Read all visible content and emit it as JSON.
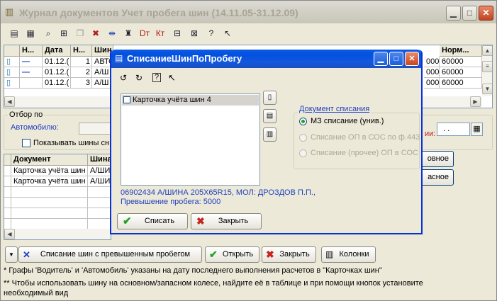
{
  "main": {
    "title": "Журнал документов  Учет пробега шин (14.11.05-31.12.09)"
  },
  "top_grid": {
    "headers": [
      "Н...",
      "Дата",
      "Н...",
      "Шин",
      "Норм..."
    ],
    "rows": [
      {
        "date": "01.12.(",
        "num": "1",
        "tire": "АВТО",
        "val": "000",
        "norm": "60000"
      },
      {
        "date": "01.12.(",
        "num": "2",
        "tire": "А/Ш",
        "val": "000",
        "norm": "60000"
      },
      {
        "date": "01.12.(",
        "num": "3",
        "tire": "А/Ш",
        "val": "000",
        "norm": "60000"
      }
    ]
  },
  "filter": {
    "group_label": "Отбор по",
    "auto_label": "Автомобилю:",
    "show_tires_label": "Показывать шины сн",
    "date_suffix_label": "ии:",
    "date_value": ". ."
  },
  "bottom_grid": {
    "headers": [
      "Документ",
      "Шина"
    ],
    "rows": [
      {
        "doc": "Карточка учёта шин",
        "tire": "А/ШИ"
      },
      {
        "doc": "Карточка учёта шин",
        "tire": "А/ШИ"
      }
    ]
  },
  "right_buttons": {
    "basic": "овное",
    "spare": "асное"
  },
  "bottom_bar": {
    "writeoff_label": "Списание шин с превышенным пробегом",
    "open_label": "Открыть",
    "close_label": "Закрыть",
    "columns_label": "Колонки"
  },
  "notes": {
    "line1": "* Графы 'Водитель' и 'Автомобиль' указаны на дату последнего выполнения расчетов в \"Карточках шин\"",
    "line2": "** Чтобы использовать шину на основном/запасном колесе, найдите её в таблице и при помощи кнопок установите",
    "line3": "необходимый вид"
  },
  "dialog": {
    "title": "СписаниеШинПоПробегу",
    "list_item": "Карточка учёта шин 4",
    "doc_group_label": "Документ списания",
    "options": [
      {
        "label": "МЗ списание (унив.)",
        "selected": true,
        "enabled": true
      },
      {
        "label": "Списание ОП в СОС по ф.443",
        "selected": false,
        "enabled": false
      },
      {
        "label": "Списание (прочее) ОП в СОС",
        "selected": false,
        "enabled": false
      }
    ],
    "info_line1": "06902434 А/ШИНА 205Х65R15, МОЛ: ДРОЗДОВ П.П.,",
    "info_line2": "Превышение пробега: 5000",
    "writeoff_button": "Списать",
    "close_button": "Закрыть"
  },
  "colors": {
    "accent_blue": "#0831d9",
    "info_text": "#1f3fbf",
    "ok_green": "#21a121",
    "cancel_red": "#c8241f"
  }
}
